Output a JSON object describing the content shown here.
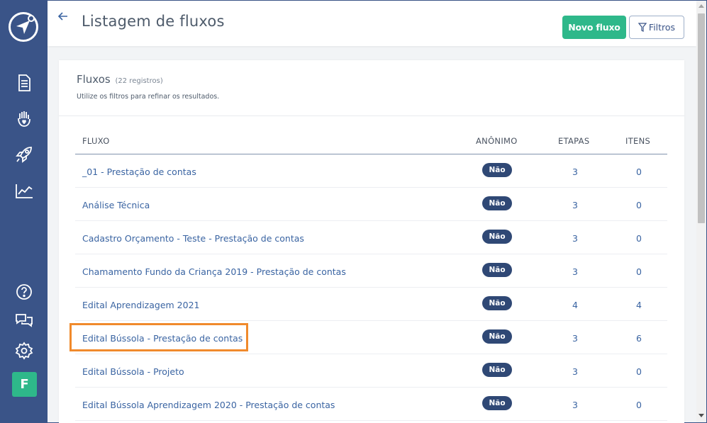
{
  "header": {
    "title": "Listagem de fluxos",
    "new_button": "Novo fluxo",
    "filter_button": "Filtros"
  },
  "card": {
    "title": "Fluxos",
    "count": "(22 registros)",
    "hint": "Utilize os filtros para refinar os resultados."
  },
  "table": {
    "columns": {
      "flow": "FLUXO",
      "anonymous": "ANÔNIMO",
      "steps": "ETAPAS",
      "items": "ITENS"
    },
    "rows": [
      {
        "name": "_01 - Prestação de contas",
        "anonymous": "Não",
        "steps": "3",
        "items": "0"
      },
      {
        "name": "Análise Técnica",
        "anonymous": "Não",
        "steps": "3",
        "items": "0"
      },
      {
        "name": "Cadastro Orçamento - Teste - Prestação de contas",
        "anonymous": "Não",
        "steps": "3",
        "items": "0"
      },
      {
        "name": "Chamamento Fundo da Criança 2019 - Prestação de contas",
        "anonymous": "Não",
        "steps": "3",
        "items": "0"
      },
      {
        "name": "Edital Aprendizagem 2021",
        "anonymous": "Não",
        "steps": "4",
        "items": "4"
      },
      {
        "name": "Edital Bússola - Prestação de contas",
        "anonymous": "Não",
        "steps": "3",
        "items": "6"
      },
      {
        "name": "Edital Bússola - Projeto",
        "anonymous": "Não",
        "steps": "3",
        "items": "0"
      },
      {
        "name": "Edital Bússola Aprendizagem 2020 - Prestação de contas",
        "anonymous": "Não",
        "steps": "3",
        "items": "0"
      }
    ]
  },
  "user": {
    "initial": "F"
  },
  "colors": {
    "sidebar": "#3a5488",
    "accent_green": "#2eb88a",
    "link_blue": "#3a64a2",
    "badge": "#2f4875",
    "highlight": "#f08a2c"
  },
  "icons": {
    "logo": "navigation-arrow-icon",
    "nav": [
      "document-icon",
      "hand-heart-icon",
      "rocket-icon",
      "chart-line-icon"
    ],
    "bottom": [
      "help-icon",
      "chat-icon",
      "gear-icon"
    ]
  }
}
